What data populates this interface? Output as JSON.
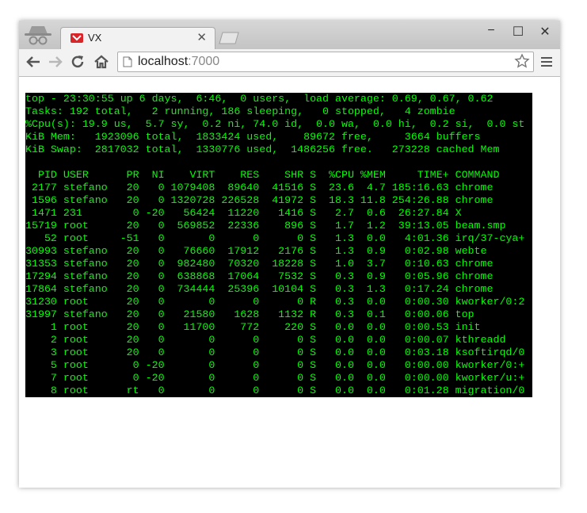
{
  "browser": {
    "tab_title": "VX",
    "tab_close": "✕",
    "url_host": "localhost",
    "url_port": ":7000",
    "win_minimize": "−",
    "win_maximize": "☐",
    "win_close": "✕"
  },
  "colors": {
    "terminal_bg": "#000000",
    "terminal_fg": "#00ff00",
    "chrome_frame": "#cfcfcf"
  },
  "terminal": {
    "summary": [
      "top - 23:30:55 up 6 days,  6:46,  0 users,  load average: 0.69, 0.67, 0.62",
      "Tasks: 192 total,   2 running, 186 sleeping,   0 stopped,   4 zombie",
      "%Cpu(s): 19.9 us,  5.7 sy,  0.2 ni, 74.0 id,  0.0 wa,  0.0 hi,  0.2 si,  0.0 st",
      "KiB Mem:   1923096 total,  1833424 used,    89672 free,     3664 buffers",
      "KiB Swap:  2817032 total,  1330776 used,  1486256 free.   273228 cached Mem"
    ],
    "blank": " ",
    "header": "  PID USER      PR  NI    VIRT    RES    SHR S  %CPU %MEM     TIME+ COMMAND",
    "processes": [
      " 2177 stefano   20   0 1079408  89640  41516 S  23.6  4.7 185:16.63 chrome",
      " 1596 stefano   20   0 1320728 226528  41972 S  18.3 11.8 254:26.88 chrome",
      " 1471 231        0 -20   56424  11220   1416 S   2.7  0.6  26:27.84 X",
      "15719 root      20   0  569852  22336    896 S   1.7  1.2  39:13.05 beam.smp",
      "   52 root     -51   0       0      0      0 S   1.3  0.0   4:01.36 irq/37-cya+",
      "30993 stefano   20   0   76660  17912   2176 S   1.3  0.9   0:02.98 webte",
      "31353 stefano   20   0  982480  70320  18228 S   1.0  3.7   0:10.63 chrome",
      "17294 stefano   20   0  638868  17064   7532 S   0.3  0.9   0:05.96 chrome",
      "17864 stefano   20   0  734444  25396  10104 S   0.3  1.3   0:17.24 chrome",
      "31230 root      20   0       0      0      0 R   0.3  0.0   0:00.30 kworker/0:2",
      "31997 stefano   20   0   21580   1628   1132 R   0.3  0.1   0:00.06 top",
      "    1 root      20   0   11700    772    220 S   0.0  0.0   0:00.53 init",
      "    2 root      20   0       0      0      0 S   0.0  0.0   0:00.07 kthreadd",
      "    3 root      20   0       0      0      0 S   0.0  0.0   0:03.18 ksoftirqd/0",
      "    5 root       0 -20       0      0      0 S   0.0  0.0   0:00.00 kworker/0:+",
      "    7 root       0 -20       0      0      0 S   0.0  0.0   0:00.00 kworker/u:+",
      "    8 root      rt   0       0      0      0 S   0.0  0.0   0:01.28 migration/0"
    ]
  }
}
